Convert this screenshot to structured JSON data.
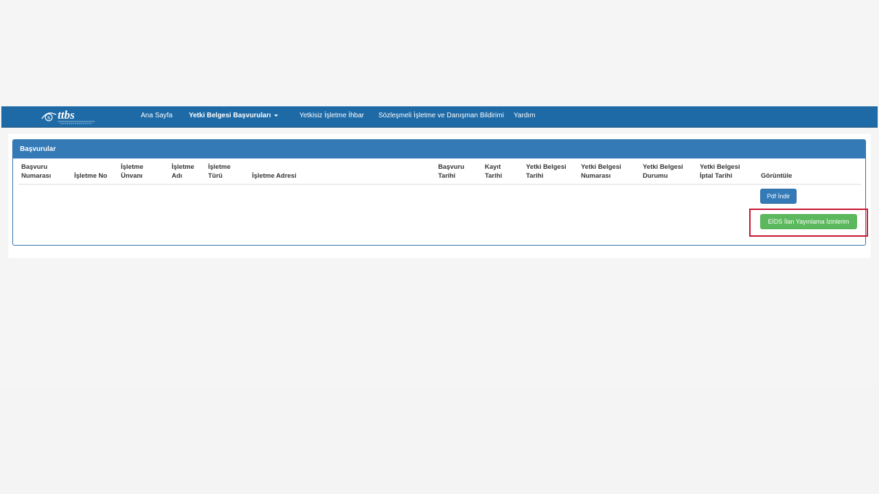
{
  "colors": {
    "navbar": "#1e6aa6",
    "panel_heading": "#337ab7",
    "primary_button": "#337ab7",
    "success_button": "#5cb85c",
    "highlight": "#c8102e"
  },
  "navbar": {
    "logo_text": "ttbs",
    "items": [
      {
        "label": "Ana Sayfa"
      },
      {
        "label": "Yetki Belgesi Başvuruları"
      },
      {
        "label": "Yetkisiz İşletme İhbar"
      },
      {
        "label": "Sözleşmeli İşletme ve Danışman Bildirimi"
      },
      {
        "label": "Yardım"
      }
    ]
  },
  "panel": {
    "title": "Başvurular",
    "columns": [
      {
        "line1": "Başvuru",
        "line2": "Numarası"
      },
      {
        "line1": "",
        "line2": "İşletme No"
      },
      {
        "line1": "İşletme",
        "line2": "Ünvanı"
      },
      {
        "line1": "İşletme",
        "line2": "Adı"
      },
      {
        "line1": "İşletme",
        "line2": "Türü"
      },
      {
        "line1": "",
        "line2": "İşletme Adresi"
      },
      {
        "line1": "Başvuru",
        "line2": "Tarihi"
      },
      {
        "line1": "Kayıt",
        "line2": "Tarihi"
      },
      {
        "line1": "Yetki Belgesi",
        "line2": "Tarihi"
      },
      {
        "line1": "Yetki Belgesi",
        "line2": "Numarası"
      },
      {
        "line1": "Yetki Belgesi",
        "line2": "Durumu"
      },
      {
        "line1": "Yetki Belgesi",
        "line2": "İptal Tarihi"
      },
      {
        "line1": "",
        "line2": "Görüntüle"
      }
    ],
    "pdf_button": "Pdf İndir",
    "eids_button": "EİDS İlan Yayınlama İzinlerim"
  }
}
